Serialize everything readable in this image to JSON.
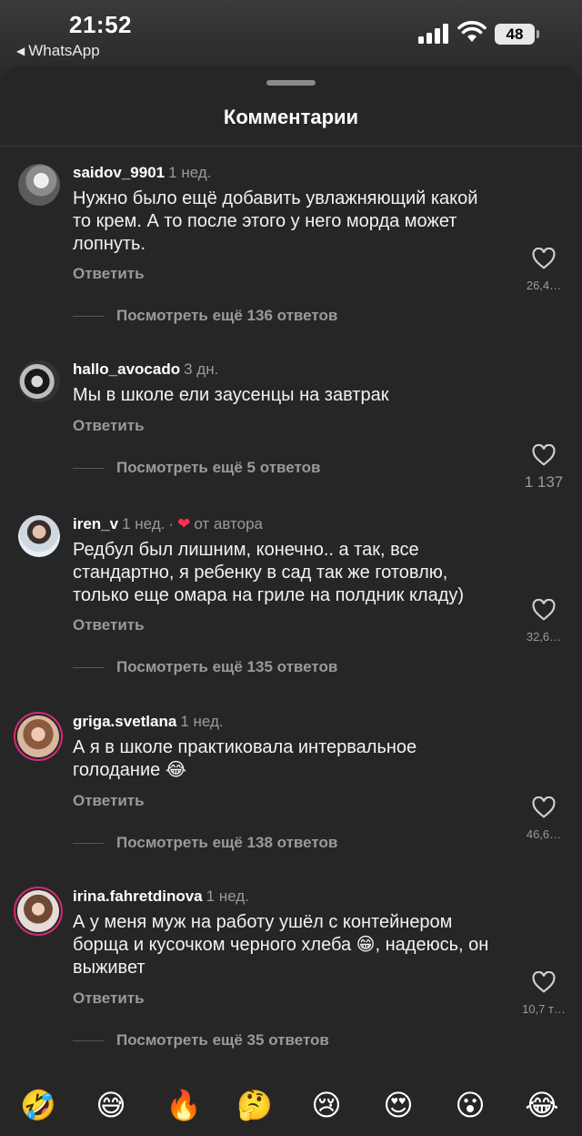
{
  "status_bar": {
    "time": "21:52",
    "back_app": "WhatsApp",
    "battery": "48"
  },
  "sheet": {
    "title": "Комментарии"
  },
  "comments": [
    {
      "username": "saidov_9901",
      "when": "1 нед.",
      "text": "Нужно было ещё добавить увлажняющий какой то крем. А то после этого у него морда может лопнуть.",
      "reply": "Ответить",
      "more_replies": "Посмотреть ещё 136 ответов",
      "likes": "26,4…"
    },
    {
      "username": "hallo_avocado",
      "when": "3 дн.",
      "text": "Мы в школе ели заусенцы на завтрак",
      "reply": "Ответить",
      "more_replies": "Посмотреть ещё 5 ответов",
      "likes": "1 137"
    },
    {
      "username": "iren_v",
      "when": "1 нед.",
      "author_badge": "от автора",
      "text": "Редбул был лишним, конечно.. а так, все стандартно, я ребенку в сад так же готовлю, только еще омара на гриле на полдник кладу)",
      "reply": "Ответить",
      "more_replies": "Посмотреть ещё 135 ответов",
      "likes": "32,6…"
    },
    {
      "username": "griga.svetlana",
      "when": "1 нед.",
      "text": "А я в школе практиковала интервальное голодание 😂",
      "reply": "Ответить",
      "more_replies": "Посмотреть ещё 138 ответов",
      "likes": "46,6…"
    },
    {
      "username": "irina.fahretdinova",
      "when": "1 нед.",
      "text": "А у меня муж на работу ушёл с контейнером борща и кусочком черного хлеба 😁, надеюсь, он выживет",
      "reply": "Ответить",
      "more_replies": "Посмотреть ещё 35 ответов",
      "likes": "10,7 т…"
    }
  ],
  "emoji_bar": [
    "🤣",
    "😅",
    "🔥",
    "🤔",
    "😢",
    "😍",
    "😮",
    "😂"
  ],
  "colors": {
    "sheet_bg": "#262626",
    "muted_text": "#9a9a9a",
    "story_ring": "#d62976",
    "author_heart": "#ff2d55"
  },
  "icons": {
    "like": "heart-outline-icon",
    "author_like": "heart-filled-icon",
    "back": "back-triangle-icon",
    "signal": "cellular-signal-icon",
    "wifi": "wifi-icon",
    "battery": "battery-icon"
  }
}
